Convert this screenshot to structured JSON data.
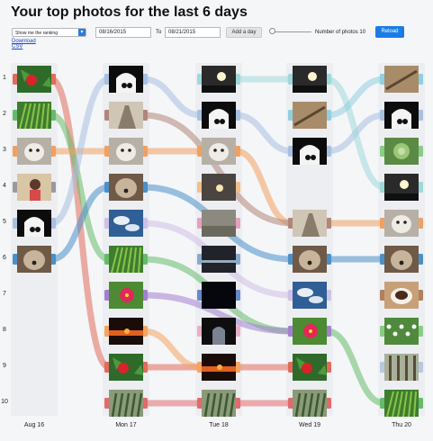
{
  "title": "Your top photos for the last 6 days",
  "controls": {
    "ranking_select": "Show me the ranking",
    "date_from": "08/16/2015",
    "to_label": "To",
    "date_to": "08/21/2015",
    "add_day": "Add a day",
    "num_photos_label": "Number of photos 10",
    "reload": "Reload",
    "download_csv": "Download CSV"
  },
  "ranks": [
    "1",
    "2",
    "3",
    "4",
    "5",
    "6",
    "7",
    "8",
    "9",
    "10"
  ],
  "days": [
    "Aug 16",
    "Mon 17",
    "Tue 18",
    "Wed 19",
    "Thu 20"
  ],
  "photos": [
    {
      "id": "strawberry",
      "color": "#e06b5b",
      "ranks": [
        1,
        9,
        null,
        9,
        null
      ],
      "art": "strawberry"
    },
    {
      "id": "fern",
      "color": "#66bb6a",
      "ranks": [
        2,
        6,
        null,
        8,
        10
      ],
      "art": "fern"
    },
    {
      "id": "cat",
      "color": "#f0a060",
      "ranks": [
        3,
        3,
        3,
        5,
        5
      ],
      "art": "cat"
    },
    {
      "id": "girl",
      "color": "#9a9a9a",
      "ranks": [
        4,
        null,
        null,
        null,
        null
      ],
      "art": "girl"
    },
    {
      "id": "arch",
      "color": "#a8c0e0",
      "ranks": [
        5,
        1,
        2,
        3,
        2
      ],
      "art": "arch"
    },
    {
      "id": "dog",
      "color": "#4a90c8",
      "ranks": [
        6,
        4,
        null,
        6,
        6
      ],
      "art": "dog"
    },
    {
      "id": "palms",
      "color": "#e06b6b",
      "ranks": [
        null,
        10,
        10,
        10,
        null
      ],
      "art": "palms"
    },
    {
      "id": "sunset",
      "color": "#f4a460",
      "ranks": [
        null,
        8,
        9,
        null,
        null
      ],
      "art": "sunset"
    },
    {
      "id": "hibiscus",
      "color": "#a47fd0",
      "ranks": [
        null,
        7,
        null,
        8,
        null
      ],
      "art": "hibiscus"
    },
    {
      "id": "alley",
      "color": "#b0867a",
      "ranks": [
        null,
        2,
        null,
        5,
        null
      ],
      "art": "alley"
    },
    {
      "id": "sky",
      "color": "#cfc0e6",
      "ranks": [
        null,
        5,
        null,
        7,
        null
      ],
      "art": "sky"
    },
    {
      "id": "sun",
      "color": "#9fd8d8",
      "ranks": [
        null,
        null,
        1,
        1,
        4
      ],
      "art": "sun"
    },
    {
      "id": "crane",
      "color": "#8fd0e0",
      "ranks": [
        null,
        null,
        null,
        2,
        1
      ],
      "art": "crane"
    },
    {
      "id": "dusk",
      "color": "#f0c088",
      "ranks": [
        null,
        null,
        4,
        null,
        null
      ],
      "art": "dusk"
    },
    {
      "id": "field",
      "color": "#e6a0c0",
      "ranks": [
        null,
        null,
        5,
        null,
        null
      ],
      "art": "field"
    },
    {
      "id": "bridge",
      "color": "#88aacc",
      "ranks": [
        null,
        null,
        6,
        null,
        null
      ],
      "art": "bridge"
    },
    {
      "id": "night",
      "color": "#6688cc",
      "ranks": [
        null,
        null,
        7,
        null,
        null
      ],
      "art": "night"
    },
    {
      "id": "tunnel",
      "color": "#e8b0c8",
      "ranks": [
        null,
        null,
        8,
        null,
        null
      ],
      "art": "tunnel"
    },
    {
      "id": "coffee",
      "color": "#b08060",
      "ranks": [
        null,
        null,
        null,
        null,
        7
      ],
      "art": "coffee"
    },
    {
      "id": "flowers",
      "color": "#88cc88",
      "ranks": [
        null,
        null,
        null,
        null,
        8
      ],
      "art": "flowers"
    },
    {
      "id": "forest",
      "color": "#b8c8e0",
      "ranks": [
        null,
        null,
        null,
        null,
        9
      ],
      "art": "forest"
    },
    {
      "id": "succulent",
      "color": "#88cc88",
      "ranks": [
        null,
        null,
        null,
        null,
        3
      ],
      "art": "succulent"
    }
  ]
}
